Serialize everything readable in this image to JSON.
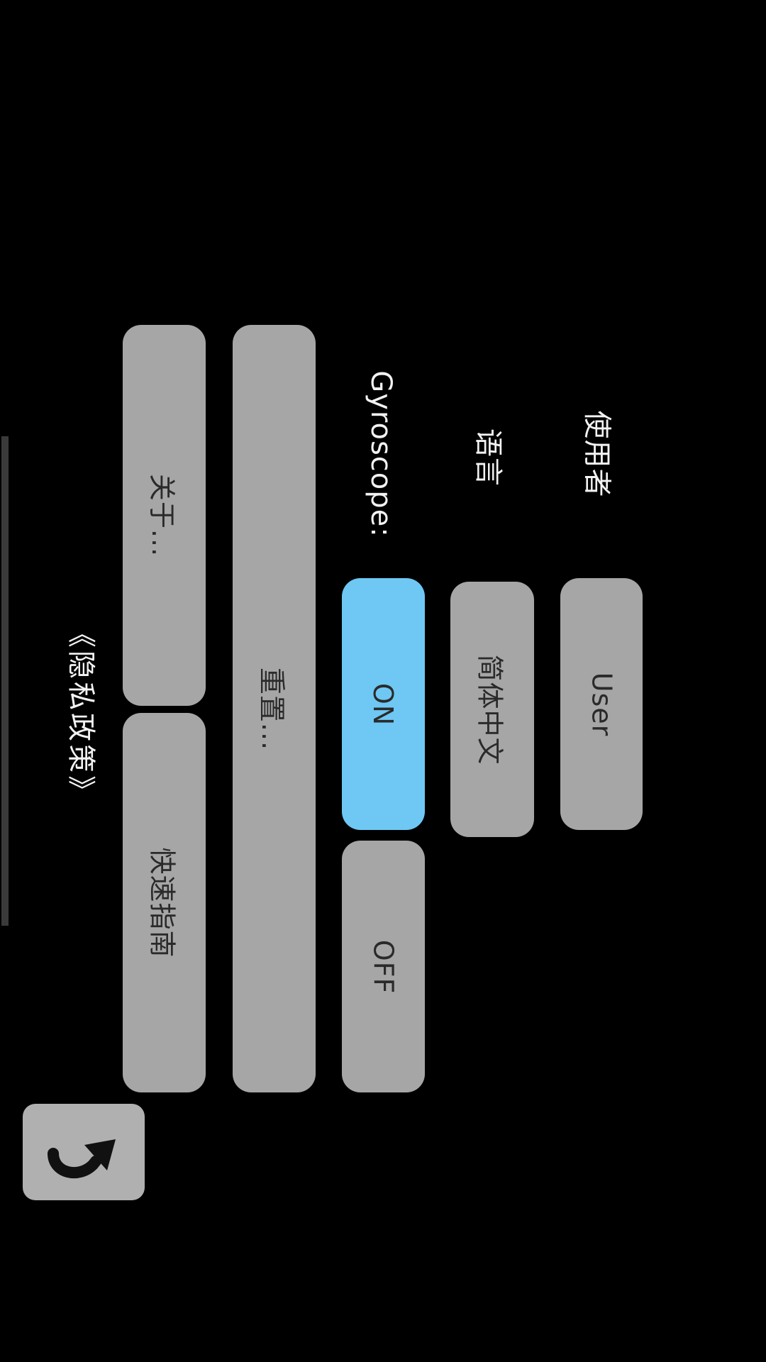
{
  "settings": {
    "user_label": "使用者",
    "user_value": "User",
    "language_label": "语言",
    "language_value": "简体中文",
    "gyroscope_label": "Gyroscope:",
    "gyroscope_on": "ON",
    "gyroscope_off": "OFF",
    "gyroscope_state": "ON"
  },
  "actions": {
    "reset_label": "重置...",
    "about_label": "关于...",
    "quick_guide_label": "快速指南"
  },
  "footer": {
    "privacy_label": "《隐私政策》"
  },
  "icons": {
    "back": "return-arrow-icon"
  },
  "colors": {
    "background": "#000000",
    "button": "#a6a6a6",
    "selected": "#6ec8f3"
  }
}
